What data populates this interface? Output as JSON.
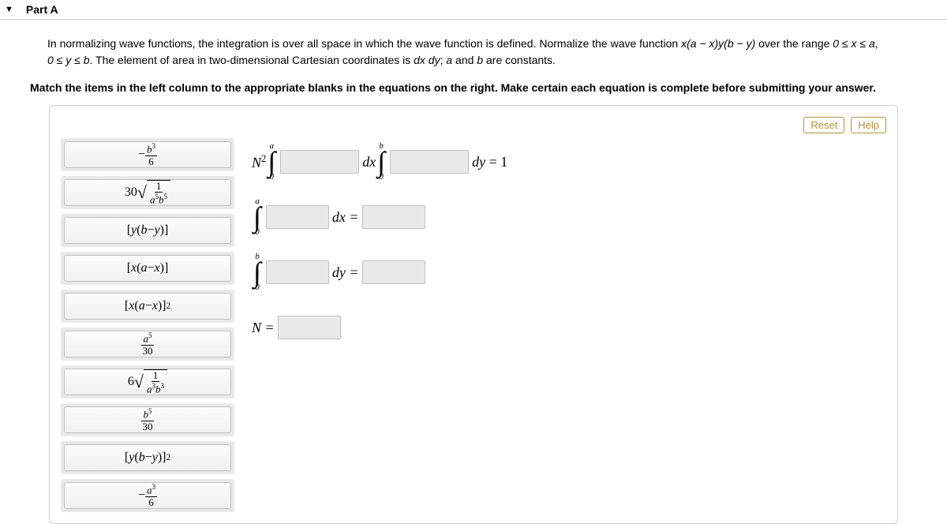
{
  "header": {
    "part_label": "Part A"
  },
  "intro": {
    "line1_a": "In normalizing wave functions, the integration is over all space in which the wave function is defined. Normalize the wave function ",
    "line1_math": "x(a − x)y(b − y)",
    "line1_b": " over the range ",
    "line1_math2": "0 ≤ x ≤ a",
    "line1_c": ", ",
    "line2_math": "0 ≤ y ≤ b",
    "line2_a": ". The element of area in two-dimensional Cartesian coordinates is ",
    "line2_math2": "dx dy",
    "line2_b": "; ",
    "line2_math3": "a",
    "line2_c": " and ",
    "line2_math4": "b",
    "line2_d": " are constants."
  },
  "instruction": "Match the items in the left column to the appropriate blanks in the equations on the right. Make certain each equation is complete before submitting your answer.",
  "buttons": {
    "reset": "Reset",
    "help": "Help"
  },
  "tiles": [
    {
      "id": "t1",
      "html": "−<span class='frac'><span class='n'><i>b</i><sup>3</sup></span><span class='d'>6</span></span>"
    },
    {
      "id": "t2",
      "html": "30<span class='sqrt'><span class='rad'>√</span><span class='under'><span class='frac'><span class='n'>1</span><span class='d'><i>a</i><sup>5</sup><i>b</i><sup>5</sup></span></span></span></span>"
    },
    {
      "id": "t3",
      "html": "[<i>y</i>(<i>b</i> − <i>y</i>)]"
    },
    {
      "id": "t4",
      "html": "[<i>x</i>(<i>a</i> − <i>x</i>)]"
    },
    {
      "id": "t5",
      "html": "[<i>x</i>(<i>a</i> − <i>x</i>)]<sup>2</sup>"
    },
    {
      "id": "t6",
      "html": "<span class='frac'><span class='n'><i>a</i><sup>5</sup></span><span class='d'>30</span></span>"
    },
    {
      "id": "t7",
      "html": "6<span class='sqrt'><span class='rad'>√</span><span class='under'><span class='frac'><span class='n'>1</span><span class='d'><i>a</i><sup>3</sup><i>b</i><sup>3</sup></span></span></span></span>"
    },
    {
      "id": "t8",
      "html": "<span class='frac'><span class='n'><i>b</i><sup>5</sup></span><span class='d'>30</span></span>"
    },
    {
      "id": "t9",
      "html": "[<i>y</i>(<i>b</i> − <i>y</i>)]<sup>2</sup>"
    },
    {
      "id": "t10",
      "html": "−<span class='frac'><span class='n'><i>a</i><sup>3</sup></span><span class='d'>6</span></span>"
    }
  ],
  "equations": {
    "row1": {
      "pre": "N",
      "sup": "2",
      "int1_up": "a",
      "int1_lo": "0",
      "dx": "dx",
      "int2_up": "b",
      "int2_lo": "0",
      "dy": "dy",
      "eq": "= 1"
    },
    "row2": {
      "int_up": "a",
      "int_lo": "0",
      "dx": "dx =",
      "eq": ""
    },
    "row3": {
      "int_up": "b",
      "int_lo": "0",
      "dy": "dy =",
      "eq": ""
    },
    "row4": {
      "pre": "N =",
      "eq": ""
    }
  }
}
